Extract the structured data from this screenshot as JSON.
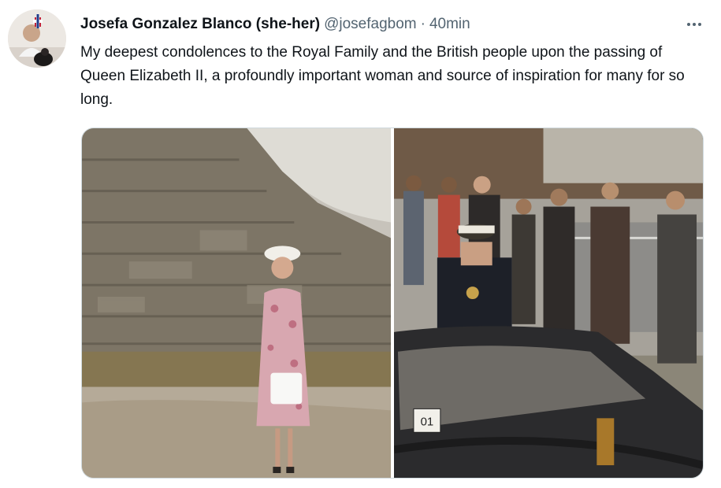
{
  "tweet": {
    "display_name": "Josefa Gonzalez Blanco (she-her)",
    "handle": "@josefagbom",
    "separator": "·",
    "timestamp": "40min",
    "text": "My deepest condolences to the Royal Family and the British people upon the passing of Queen Elizabeth II, a profoundly important woman and source of inspiration for many for so long.",
    "more_icon": "more-horizontal-icon"
  },
  "media": {
    "photos": [
      {
        "name": "queen-at-pyramid-photo"
      },
      {
        "name": "prince-in-car-photo",
        "plate_text": "01"
      }
    ]
  },
  "colors": {
    "text_primary": "#0f1419",
    "text_secondary": "#536471",
    "border": "#cfd9de"
  }
}
